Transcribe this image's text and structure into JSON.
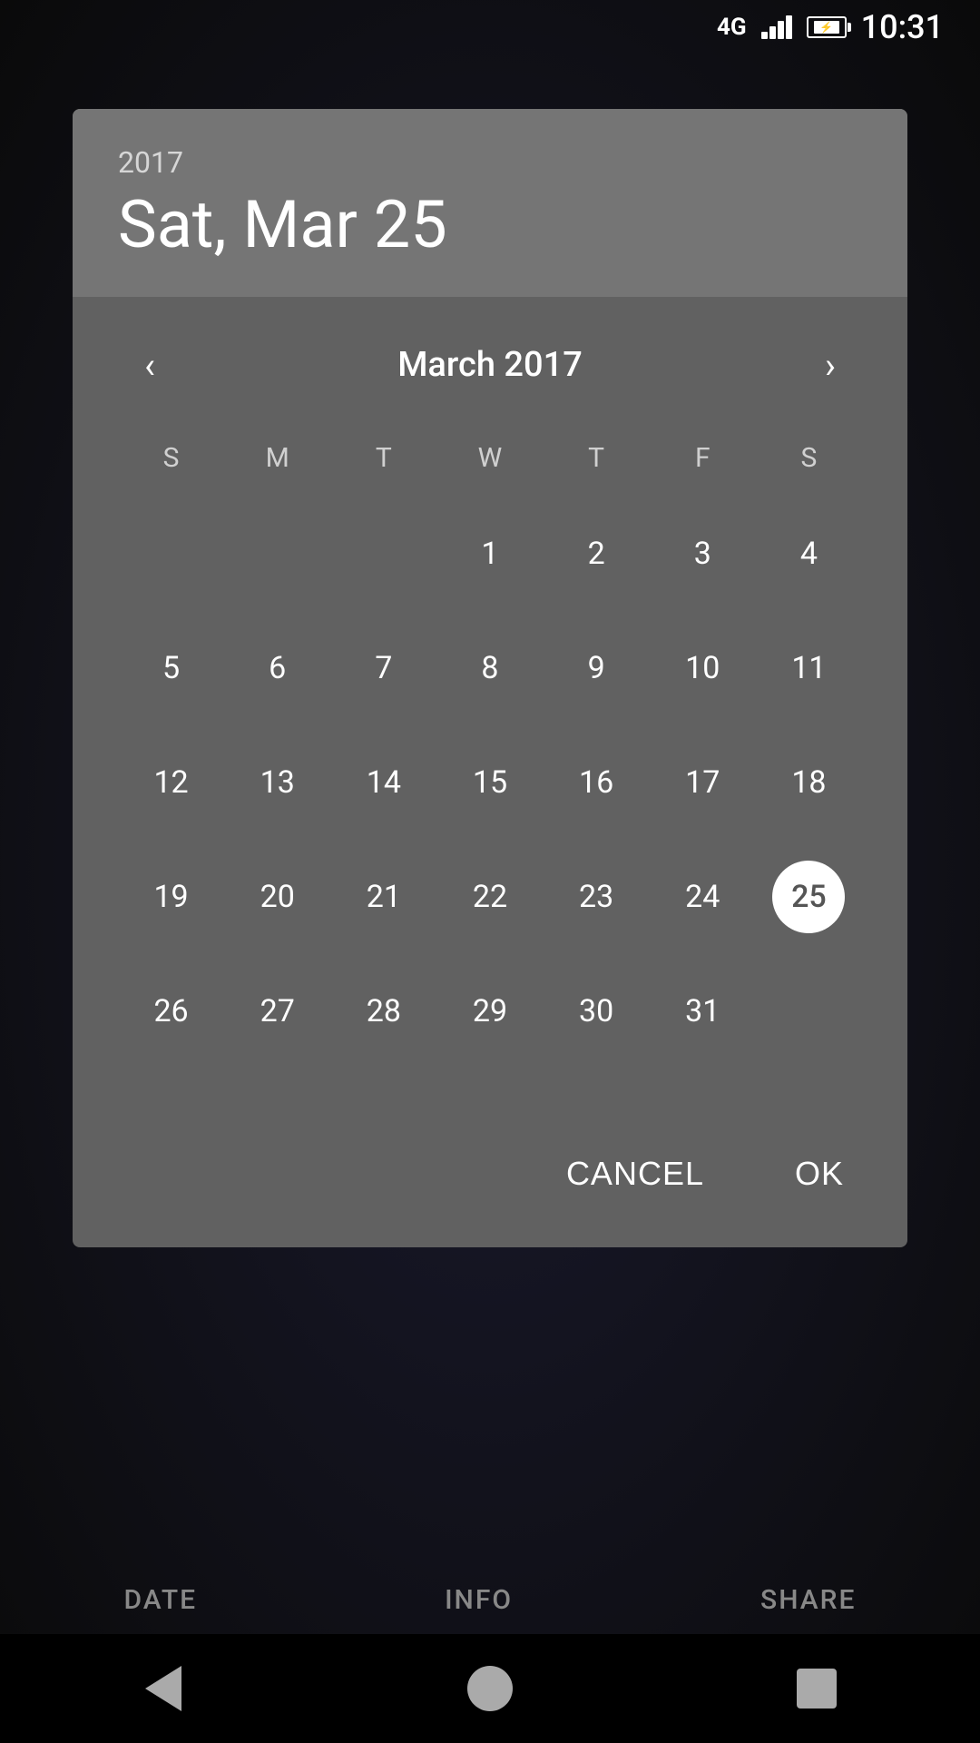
{
  "statusBar": {
    "signal": "4G",
    "time": "10:31"
  },
  "dialog": {
    "year": "2017",
    "selectedDateLabel": "Sat, Mar 25",
    "monthLabel": "March 2017",
    "selectedDay": 25,
    "daysOfWeek": [
      "S",
      "M",
      "T",
      "W",
      "T",
      "F",
      "S"
    ],
    "weeks": [
      [
        null,
        null,
        null,
        1,
        2,
        3,
        4
      ],
      [
        5,
        6,
        7,
        8,
        9,
        10,
        11
      ],
      [
        12,
        13,
        14,
        15,
        16,
        17,
        18
      ],
      [
        19,
        20,
        21,
        22,
        23,
        24,
        25
      ],
      [
        26,
        27,
        28,
        29,
        30,
        31,
        null
      ]
    ],
    "cancelLabel": "CANCEL",
    "okLabel": "OK"
  },
  "bottomTabs": {
    "date": "DATE",
    "info": "INFO",
    "share": "SHARE"
  }
}
